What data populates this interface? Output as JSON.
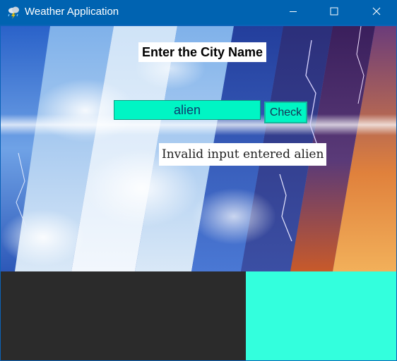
{
  "window": {
    "title": "Weather Application",
    "app_icon": "weather-storm-icon",
    "controls": {
      "minimize_icon": "minimize-icon",
      "maximize_icon": "maximize-icon",
      "close_icon": "close-icon"
    }
  },
  "main": {
    "heading": "Enter the City Name",
    "city_input": {
      "value": "alien",
      "placeholder": ""
    },
    "check_button_label": "Check",
    "result_text": "Invalid input entered alien"
  },
  "colors": {
    "titlebar": "#0063b1",
    "input_background": "#00f5c4",
    "bottom_panel_left": "#2b2b2b",
    "bottom_panel_right": "#33ffdd"
  }
}
